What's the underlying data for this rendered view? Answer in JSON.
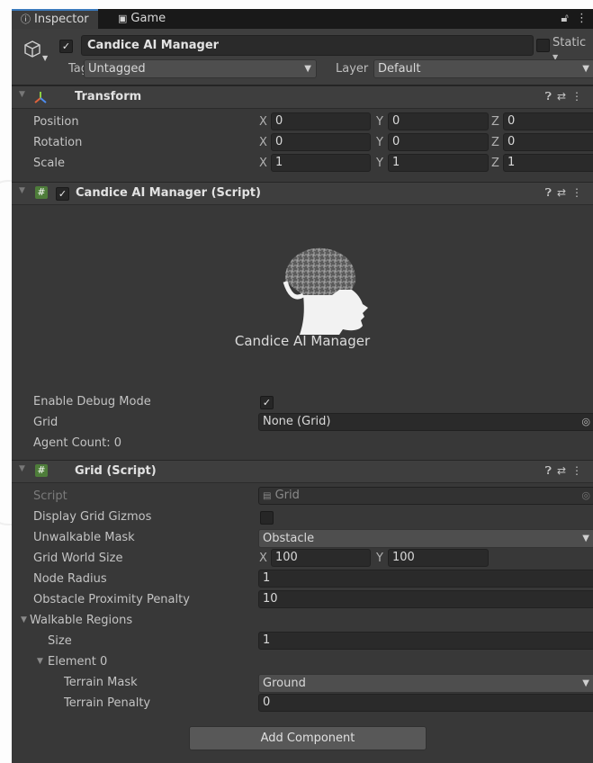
{
  "tabs": [
    {
      "label": "Inspector",
      "icon": "info-icon",
      "active": true
    },
    {
      "label": "Game",
      "icon": "gamepad-icon",
      "active": false
    }
  ],
  "gameobject": {
    "name": "Candice AI Manager",
    "active": true,
    "static_label": "Static",
    "tag_label": "Tag",
    "tag_value": "Untagged",
    "layer_label": "Layer",
    "layer_value": "Default"
  },
  "transform": {
    "title": "Transform",
    "rows": [
      {
        "label": "Position",
        "x": "0",
        "y": "0",
        "z": "0"
      },
      {
        "label": "Rotation",
        "x": "0",
        "y": "0",
        "z": "0"
      },
      {
        "label": "Scale",
        "x": "1",
        "y": "1",
        "z": "1"
      }
    ],
    "axis_labels": {
      "x": "X",
      "y": "Y",
      "z": "Z"
    }
  },
  "candice_script": {
    "title": "Candice AI Manager (Script)",
    "enabled": true,
    "logo_text": "Candice AI Manager",
    "enable_debug_label": "Enable Debug Mode",
    "enable_debug_value": true,
    "grid_label": "Grid",
    "grid_value": "None (Grid)",
    "agent_count": "Agent Count: 0"
  },
  "grid_script": {
    "title": "Grid (Script)",
    "script_label": "Script",
    "script_value": "Grid",
    "display_gizmos_label": "Display Grid Gizmos",
    "display_gizmos_value": false,
    "unwalkable_label": "Unwalkable Mask",
    "unwalkable_value": "Obstacle",
    "world_size_label": "Grid World Size",
    "world_size_x": "100",
    "world_size_y": "100",
    "node_radius_label": "Node Radius",
    "node_radius_value": "1",
    "obstacle_penalty_label": "Obstacle Proximity Penalty",
    "obstacle_penalty_value": "10",
    "walkable_label": "Walkable Regions",
    "size_label": "Size",
    "size_value": "1",
    "element_label": "Element 0",
    "terrain_mask_label": "Terrain Mask",
    "terrain_mask_value": "Ground",
    "terrain_penalty_label": "Terrain Penalty",
    "terrain_penalty_value": "0"
  },
  "add_component_label": "Add Component",
  "colors": {
    "panel": "#383838",
    "tabbar": "#191919",
    "accent": "#3a79bb",
    "field": "#2a2a2a"
  }
}
